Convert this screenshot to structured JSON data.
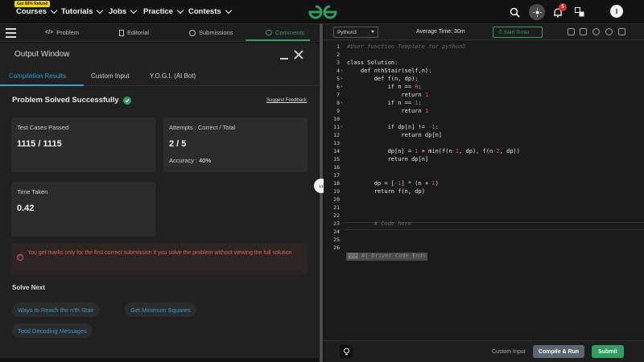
{
  "topnav": {
    "promo": "Get 90% Refund",
    "items": [
      {
        "label": "Courses"
      },
      {
        "label": "Tutorials"
      },
      {
        "label": "Jobs"
      },
      {
        "label": "Practice"
      },
      {
        "label": "Contests"
      }
    ],
    "notifications_count": "5",
    "avatar_letter": "I",
    "icons": [
      "search-icon",
      "theme-toggle-icon",
      "bell-icon",
      "translate-icon"
    ]
  },
  "tabs": [
    {
      "label": "Problem",
      "icon": "code-icon"
    },
    {
      "label": "Editorial",
      "icon": "document-icon"
    },
    {
      "label": "Submissions",
      "icon": "clock-icon"
    },
    {
      "label": "Comments",
      "icon": "comment-icon"
    }
  ],
  "output": {
    "title": "Output Window",
    "subtabs": [
      {
        "label": "Compilation Results"
      },
      {
        "label": "Custom Input"
      },
      {
        "label": "Y.O.G.I. (AI Bot)"
      }
    ],
    "status": "Problem Solved Successfully",
    "suggest": "Suggest Feedback",
    "test_cases_label": "Test Cases Passed",
    "test_cases_value": "1115 / 1115",
    "attempts_label": "Attempts : Correct / Total",
    "attempts_value": "2 / 5",
    "accuracy_label": "Accuracy :",
    "accuracy_value": "40%",
    "time_label": "Time Taken",
    "time_value": "0.42",
    "warning": "You get marks only for the first correct submission if you solve the problem without viewing the full solution",
    "solve_next_label": "Solve Next",
    "solve_next": [
      {
        "label": "Ways to Reach the n'th Stair"
      },
      {
        "label": "Get Minimum Squares"
      },
      {
        "label": "Total Decoding Messages"
      }
    ]
  },
  "editor": {
    "language": "Python3",
    "avg_time": "Average Time: 30m",
    "timer": "Start Timer",
    "lines": [
      "#User function Template for python3",
      "",
      "class Solution:",
      "    def nthStair(self,n):",
      "        def f(n, dp):",
      "            if n == 0:",
      "                return 1",
      "            if n == 1:",
      "                return 1",
      "",
      "            if dp[n] != -1:",
      "                return dp[n]",
      "",
      "            dp[n] = 1 + min(f(n-1, dp), f(n-2, dp))",
      "            return dp[n]",
      "",
      "",
      "        dp = [-1] * (n + 1)",
      "        return f(n, dp)",
      "",
      "",
      "",
      "        # Code here",
      "",
      "",
      "#{ Driver Code Ends"
    ],
    "driver_prefix": "...",
    "footer": {
      "custom_input": "Custom Input",
      "compile": "Compile & Run",
      "submit": "Submit"
    }
  },
  "colors": {
    "accent_green": "#2f9e5f",
    "accent_blue": "#2f9bd6",
    "warning_red": "#e06060"
  }
}
